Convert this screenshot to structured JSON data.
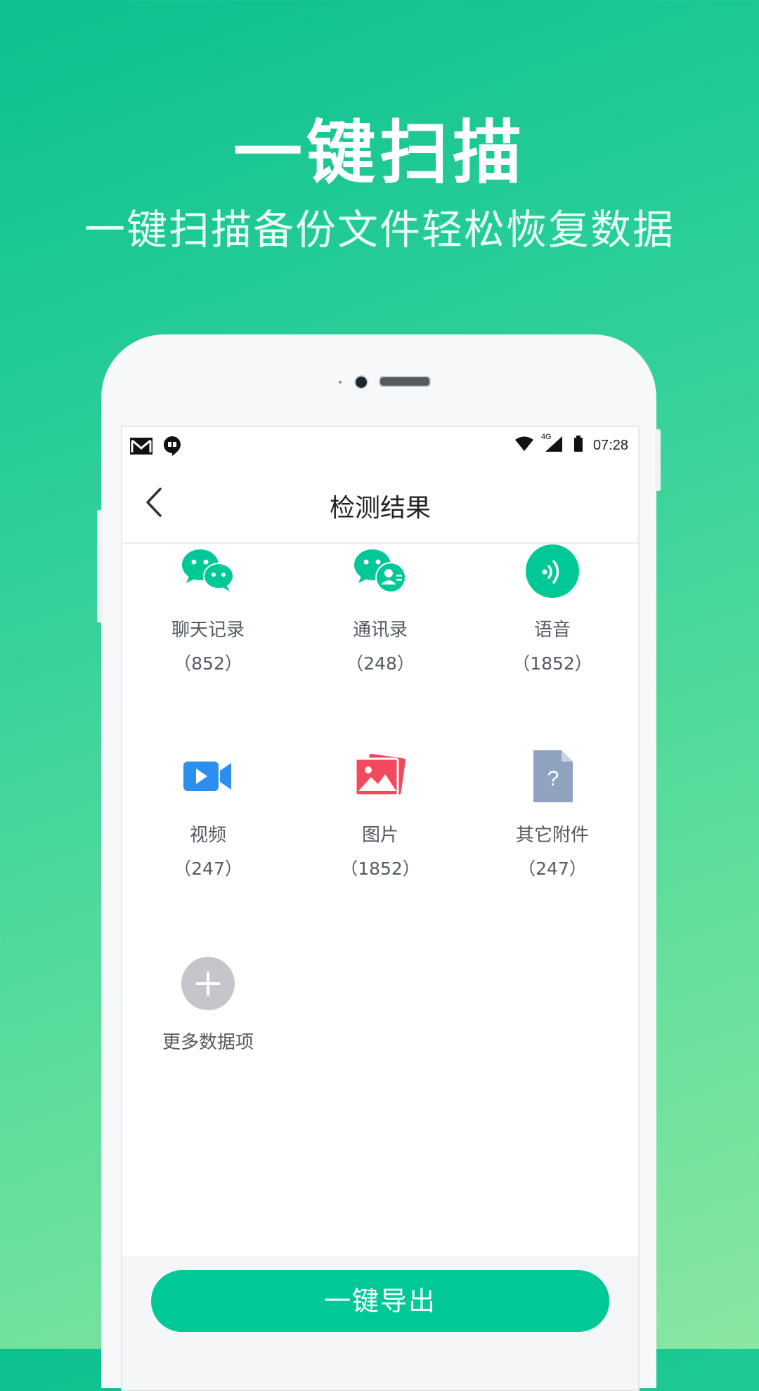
{
  "promo": {
    "headline": "一键扫描",
    "subline": "一键扫描备份文件轻松恢复数据"
  },
  "status_bar": {
    "time": "07:28",
    "network": "4G",
    "left_icons": [
      "gmail-icon",
      "hangouts-icon"
    ],
    "right_icons": [
      "wifi-icon",
      "signal-icon",
      "battery-icon"
    ]
  },
  "nav": {
    "title": "检测结果"
  },
  "items": [
    {
      "label": "聊天记录",
      "count": "（852）",
      "icon": "chat-bubbles-icon"
    },
    {
      "label": "通讯录",
      "count": "（248）",
      "icon": "contacts-chat-icon"
    },
    {
      "label": "语音",
      "count": "（1852）",
      "icon": "voice-icon"
    },
    {
      "label": "视频",
      "count": "（247）",
      "icon": "video-icon"
    },
    {
      "label": "图片",
      "count": "（1852）",
      "icon": "picture-icon"
    },
    {
      "label": "其它附件",
      "count": "（247）",
      "icon": "unknown-file-icon"
    },
    {
      "label": "更多数据项",
      "icon": "add-icon"
    }
  ],
  "footer": {
    "export_label": "一键导出"
  },
  "colors": {
    "accent": "#00c896",
    "video": "#2b8ff0",
    "picture": "#f4485c",
    "file": "#8fa3c0",
    "add": "#c4c6cc"
  }
}
